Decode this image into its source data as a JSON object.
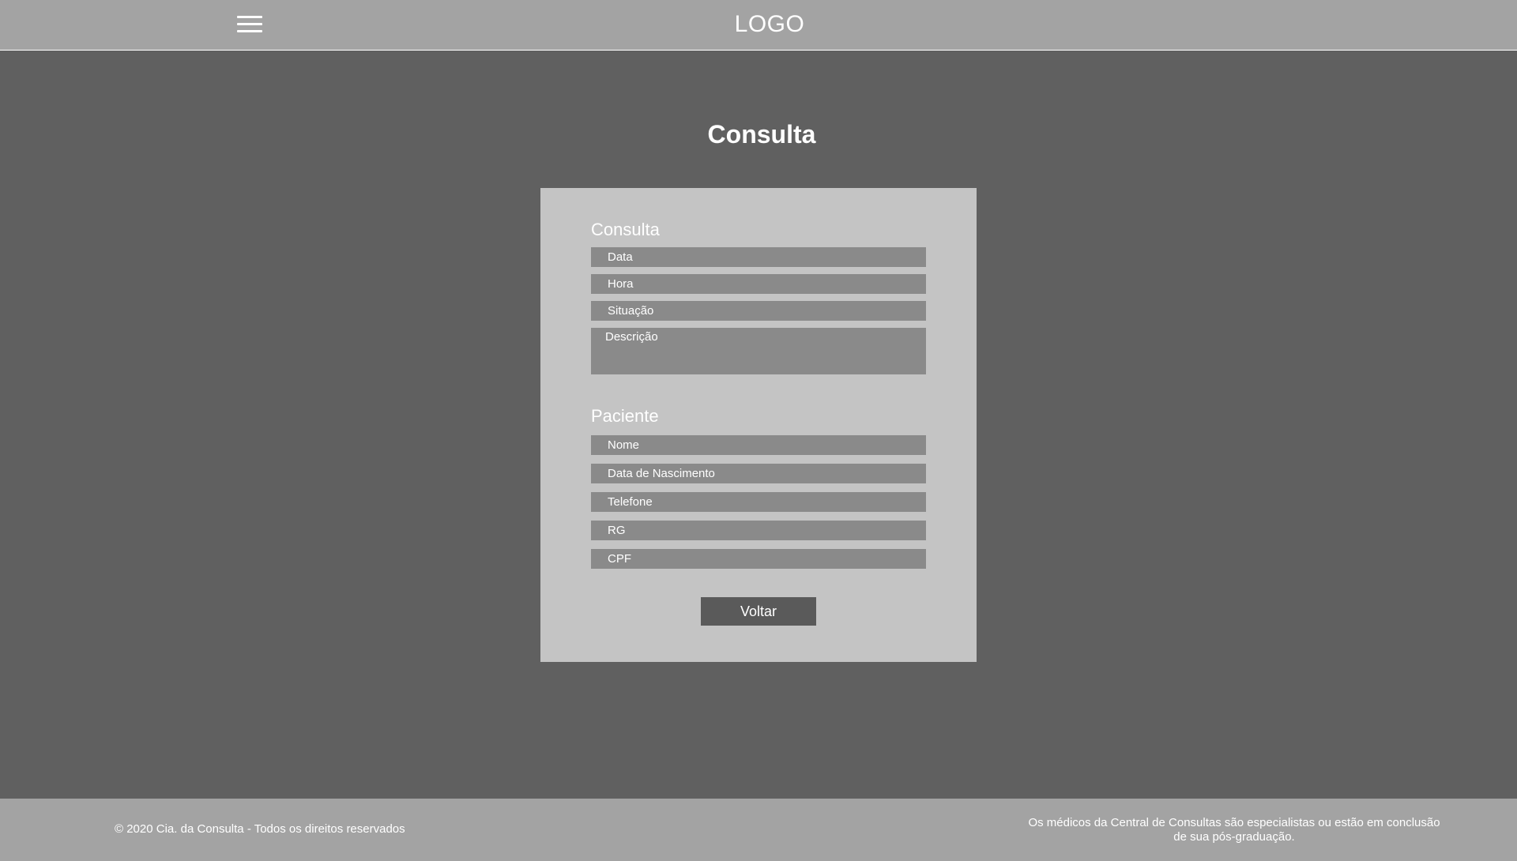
{
  "header": {
    "menu_icon": "hamburger-menu-icon",
    "logo": "LOGO"
  },
  "page": {
    "title": "Consulta"
  },
  "consulta": {
    "section_title": "Consulta",
    "fields": {
      "data": "Data",
      "hora": "Hora",
      "situacao": "Situação",
      "descricao": "Descrição"
    }
  },
  "paciente": {
    "section_title": "Paciente",
    "fields": {
      "nome": "Nome",
      "nascimento": "Data de Nascimento",
      "telefone": "Telefone",
      "rg": "RG",
      "cpf": "CPF"
    }
  },
  "actions": {
    "voltar": "Voltar"
  },
  "footer": {
    "copyright": "© 2020 Cia. da Consulta - Todos os direitos reservados",
    "disclaimer_line1": "Os médicos da Central de Consultas são especialistas ou estão em conclusão",
    "disclaimer_line2": "de sua pós-graduação."
  },
  "colors": {
    "header_bg": "#a3a3a3",
    "page_bg": "#606060",
    "card_bg": "#c4c4c4",
    "field_bg": "#8a8a8a",
    "button_bg": "#5a5a5a"
  }
}
